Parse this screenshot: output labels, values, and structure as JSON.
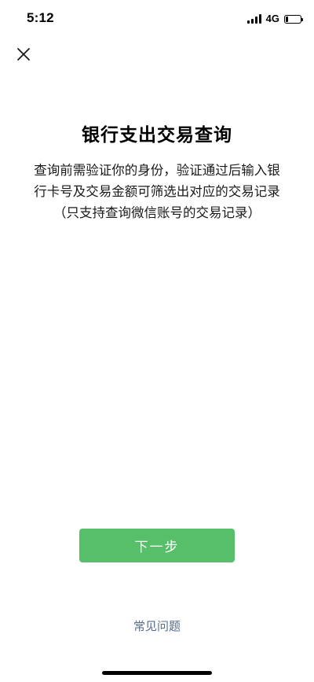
{
  "status_bar": {
    "time": "5:12",
    "network": "4G",
    "battery_level": 0.15
  },
  "header": {
    "close_icon": "close-icon"
  },
  "main": {
    "title": "银行支出交易查询",
    "description": "查询前需验证你的身份，验证通过后输入银行卡号及交易金额可筛选出对应的交易记录（只支持查询微信账号的交易记录）"
  },
  "actions": {
    "next_label": "下一步",
    "faq_label": "常见问题"
  },
  "colors": {
    "primary_button": "#57be6a",
    "link": "#576b95",
    "background": "#ffffff"
  }
}
